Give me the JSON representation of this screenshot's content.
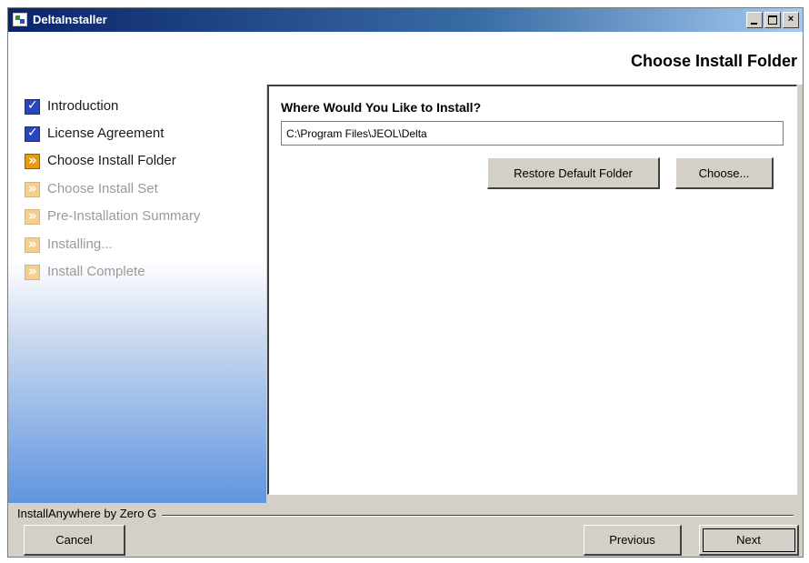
{
  "window": {
    "title": "DeltaInstaller",
    "controls": [
      "minimize",
      "maximize",
      "close"
    ],
    "close_symbol": "×"
  },
  "header": {
    "step_title": "Choose Install Folder"
  },
  "sidebar": {
    "steps": [
      {
        "label": "Introduction",
        "state": "done",
        "icon": "check-icon"
      },
      {
        "label": "License Agreement",
        "state": "done",
        "icon": "check-icon"
      },
      {
        "label": "Choose Install Folder",
        "state": "current",
        "icon": "arrow-icon"
      },
      {
        "label": "Choose Install Set",
        "state": "pending",
        "icon": "arrow-icon"
      },
      {
        "label": "Pre-Installation Summary",
        "state": "pending",
        "icon": "arrow-icon"
      },
      {
        "label": "Installing...",
        "state": "pending",
        "icon": "arrow-icon"
      },
      {
        "label": "Install Complete",
        "state": "pending",
        "icon": "arrow-icon"
      }
    ]
  },
  "panel": {
    "question": "Where Would You Like to Install?",
    "install_path": "C:\\Program Files\\JEOL\\Delta",
    "restore_label": "Restore Default Folder",
    "choose_label": "Choose..."
  },
  "footer": {
    "vendor": "InstallAnywhere by Zero G",
    "cancel_label": "Cancel",
    "previous_label": "Previous",
    "next_label": "Next"
  },
  "colors": {
    "titlebar_start": "#0a246a",
    "titlebar_end": "#a6caf0",
    "checked": "#2847b8",
    "current_step": "#e89a10",
    "pending_step": "#f3cf8f",
    "sidebar_gradient_end": "#5f95df"
  }
}
